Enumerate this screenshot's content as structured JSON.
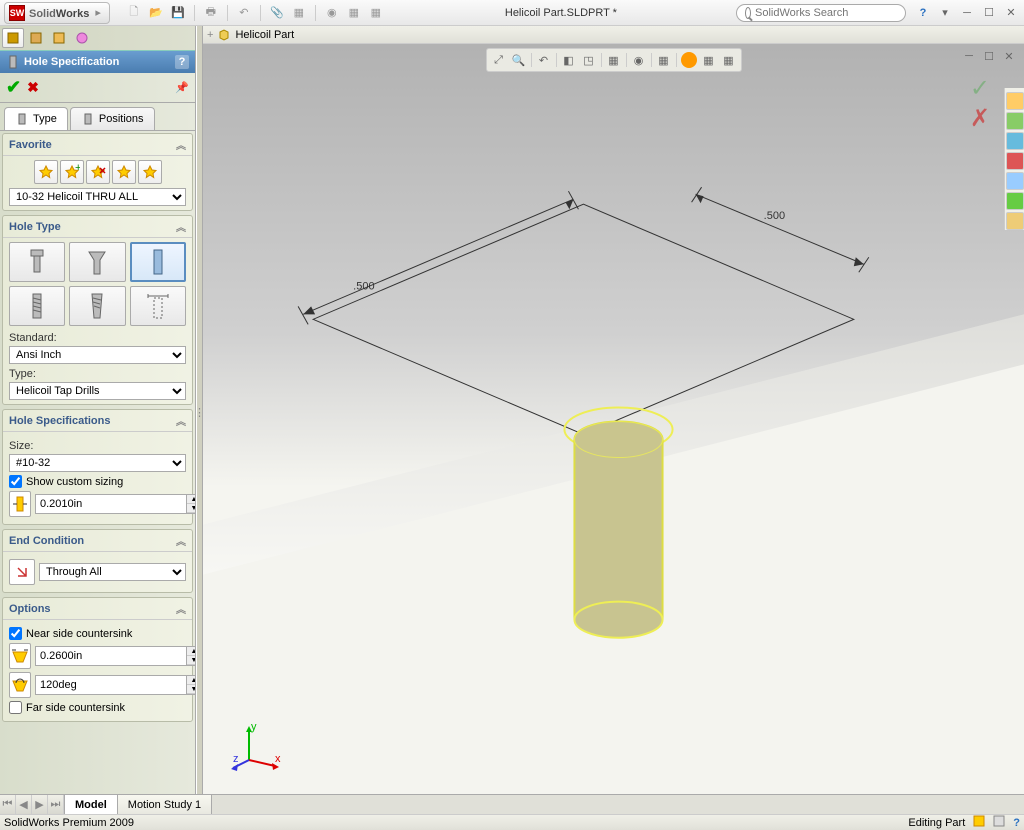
{
  "app": {
    "name_solid": "Solid",
    "name_works": "Works",
    "logo_text": "SW"
  },
  "title": "Helicoil Part.SLDPRT *",
  "search": {
    "placeholder": "SolidWorks Search"
  },
  "panel": {
    "title": "Hole Specification",
    "tabs": {
      "type": "Type",
      "positions": "Positions"
    },
    "favorite": {
      "label": "Favorite",
      "selected": "10-32 Helicoil THRU ALL"
    },
    "hole_type": {
      "label": "Hole Type",
      "standard_label": "Standard:",
      "standard_value": "Ansi Inch",
      "type_label": "Type:",
      "type_value": "Helicoil Tap Drills"
    },
    "hole_spec": {
      "label": "Hole Specifications",
      "size_label": "Size:",
      "size_value": "#10-32",
      "custom_sizing_label": "Show custom sizing",
      "custom_sizing_checked": true,
      "drill_dia": "0.2010in"
    },
    "end_cond": {
      "label": "End Condition",
      "value": "Through All"
    },
    "options": {
      "label": "Options",
      "near_csk_label": "Near side countersink",
      "near_csk_checked": true,
      "csk_dia": "0.2600in",
      "csk_angle": "120deg",
      "far_csk_label": "Far side countersink",
      "far_csk_checked": false
    }
  },
  "viewport": {
    "doc_name": "Helicoil Part",
    "dim1": ".500",
    "dim2": ".500",
    "triad": {
      "x": "x",
      "y": "y",
      "z": "z"
    }
  },
  "bottom_tabs": {
    "model": "Model",
    "motion": "Motion Study 1"
  },
  "status": {
    "left": "SolidWorks Premium 2009",
    "right": "Editing Part"
  }
}
